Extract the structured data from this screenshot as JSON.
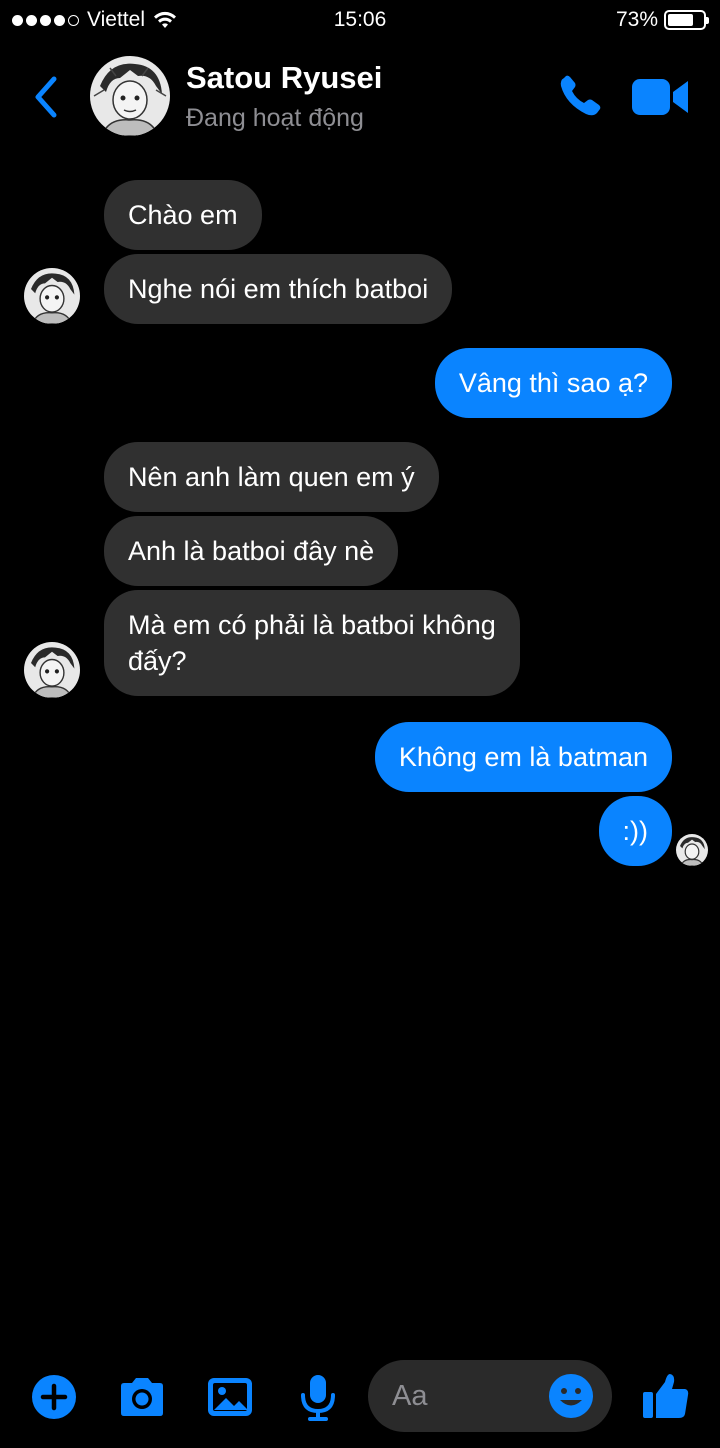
{
  "status_bar": {
    "carrier": "Viettel",
    "time": "15:06",
    "battery": "73%",
    "battery_level": 0.73
  },
  "header": {
    "name": "Satou Ryusei",
    "status": "Đang hoạt động"
  },
  "messages": [
    {
      "from": "them",
      "text": "Chào em"
    },
    {
      "from": "them",
      "text": "Nghe nói em thích batboi"
    },
    {
      "from": "me",
      "text": "Vâng thì sao ạ?"
    },
    {
      "from": "them",
      "text": "Nên anh làm quen em ý"
    },
    {
      "from": "them",
      "text": "Anh là batboi đây nè"
    },
    {
      "from": "them",
      "text": "Mà em có phải là batboi không",
      "text2": "đấy?"
    },
    {
      "from": "me",
      "text": "Không em là batman"
    },
    {
      "from": "me",
      "text": ":))"
    }
  ],
  "composer": {
    "placeholder": "Aa"
  },
  "colors": {
    "accent": "#0a84ff",
    "incoming_bubble": "#303030",
    "background": "#000000",
    "muted_text": "#8e8e93"
  },
  "icons": [
    "back-icon",
    "phone-icon",
    "video-icon",
    "plus-icon",
    "camera-icon",
    "gallery-icon",
    "microphone-icon",
    "emoji-icon",
    "thumbs-up-icon",
    "wifi-icon",
    "signal-icon",
    "battery-icon"
  ]
}
